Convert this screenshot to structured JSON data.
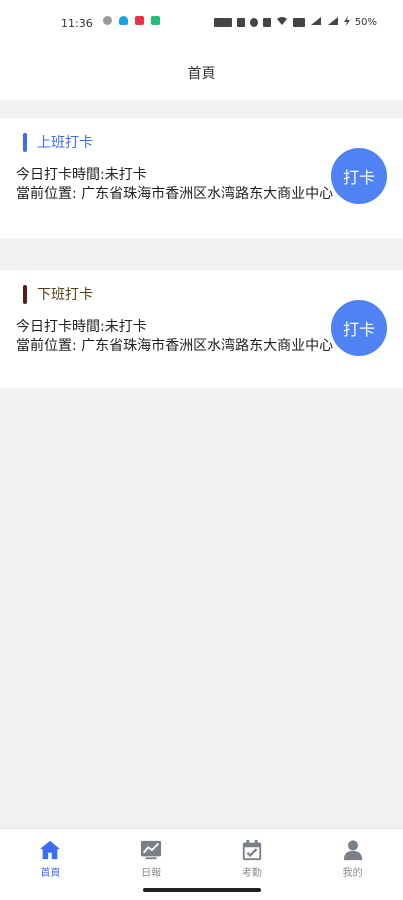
{
  "status_bar": {
    "time": "11:36",
    "battery": "50%",
    "icons": [
      "nfc-icon",
      "alarm-icon",
      "wifi-icon",
      "signal-icon",
      "battery-icon"
    ]
  },
  "header": {
    "title": "首頁"
  },
  "checkin": {
    "title": "上班打卡",
    "time_line": "今日打卡時間:未打卡",
    "location_line": "當前位置: 广东省珠海市香洲区水湾路东大商业中心",
    "button_label": "打卡",
    "accent_color": "#3d6bf2"
  },
  "checkout": {
    "title": "下班打卡",
    "time_line": "今日打卡時間:未打卡",
    "location_line": "當前位置: 广东省珠海市香洲区水湾路东大商业中心",
    "button_label": "打卡",
    "accent_color": "#5a1f14"
  },
  "tabbar": {
    "items": [
      {
        "label": "首頁",
        "icon": "home-icon",
        "active": true
      },
      {
        "label": "日報",
        "icon": "chart-icon",
        "active": false
      },
      {
        "label": "考勤",
        "icon": "calendar-check-icon",
        "active": false
      },
      {
        "label": "我的",
        "icon": "user-icon",
        "active": false
      }
    ]
  }
}
